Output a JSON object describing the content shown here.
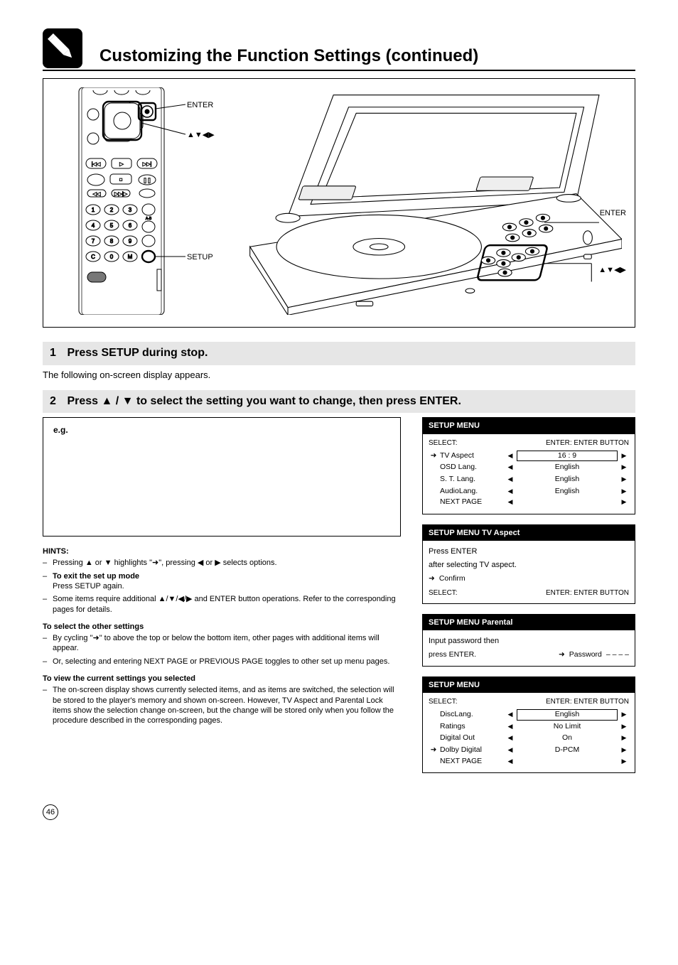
{
  "header": {
    "title": "Customizing the Function Settings (continued)"
  },
  "illustration": {
    "remote_labels": {
      "enter": "ENTER",
      "dirs": "▲▼◀▶",
      "setup": "SETUP"
    },
    "player_labels": {
      "enter": "ENTER",
      "dirs": "▲▼◀▶"
    }
  },
  "step1": {
    "bar": "Press SETUP during stop.",
    "num": "1",
    "body": "The following on-screen display appears."
  },
  "step2": {
    "bar": "Press ▲ / ▼ to select the setting you want to change, then press ENTER.",
    "num": "2",
    "example_label": "e.g.",
    "hints_title": "HINTS:",
    "sub1_bullet": "Pressing ▲ or ▼ highlights \"➜\", pressing ◀ or ▶ selects options.",
    "sub2_bullet1": "To exit the set up mode",
    "sub2_bullet1_body": "Press SETUP again.",
    "sub2_bullet2": "Some items require additional ▲/▼/◀/▶ and ENTER button operations. Refer to the corresponding pages for details.",
    "sub3_title": "To select the other settings",
    "sub3_bullet1_a": "By cycling \"➜\" to above the top or below the bottom item, other pages with additional items will appear.",
    "sub3_bullet1_b": "Or, selecting and entering NEXT PAGE or PREVIOUS PAGE toggles to other set up menu pages.",
    "sub4_title": "To view the current settings you selected",
    "sub4_bullet": "The on-screen display shows currently selected items, and as items are switched, the selection will be stored to the player's memory and shown on-screen. However, TV Aspect and Parental Lock items show the selection change on-screen, but the change will be stored only when you follow the procedure described in the corresponding pages."
  },
  "osd1": {
    "header": "SETUP MENU",
    "toprow_left": "SELECT:",
    "toprow_right": "ENTER: ENTER BUTTON",
    "rows": [
      {
        "mark": "➜",
        "label": "TV Aspect",
        "value": "16 : 9",
        "boxed": true
      },
      {
        "mark": "",
        "label": "OSD Lang.",
        "value": "English",
        "boxed": false
      },
      {
        "mark": "",
        "label": "S. T. Lang.",
        "value": "English",
        "boxed": false
      },
      {
        "mark": "",
        "label": "AudioLang.",
        "value": "English",
        "boxed": false
      },
      {
        "mark": "",
        "label": "NEXT PAGE",
        "value": "",
        "boxed": false
      }
    ]
  },
  "osd2": {
    "header": "SETUP MENU TV Aspect",
    "msg1": "Press ENTER",
    "msg2": "after selecting TV aspect.",
    "lock_row_marker": "➜",
    "lock_row_label": "Confirm",
    "caption_left": "SELECT:",
    "caption_right": "ENTER: ENTER BUTTON"
  },
  "osd3": {
    "header": "SETUP MENU Parental",
    "msg": "Input password then",
    "pw_marker": "➜",
    "pw_label": "Password",
    "pw_value": "– – – –",
    "press_enter": "press ENTER."
  },
  "osd4": {
    "header": "SETUP MENU",
    "toprow_left": "SELECT:",
    "toprow_right": "ENTER: ENTER BUTTON",
    "rows": [
      {
        "mark": "",
        "label": "DiscLang.",
        "value": "English",
        "boxed": true
      },
      {
        "mark": "",
        "label": "Ratings",
        "value": "No Limit",
        "boxed": false
      },
      {
        "mark": "",
        "label": "Digital Out",
        "value": "On",
        "boxed": false
      },
      {
        "mark": "➜",
        "label": "Dolby Digital",
        "value": "D-PCM",
        "boxed": false
      },
      {
        "mark": "",
        "label": "NEXT PAGE",
        "value": "",
        "boxed": false
      }
    ]
  },
  "page_number": "46"
}
